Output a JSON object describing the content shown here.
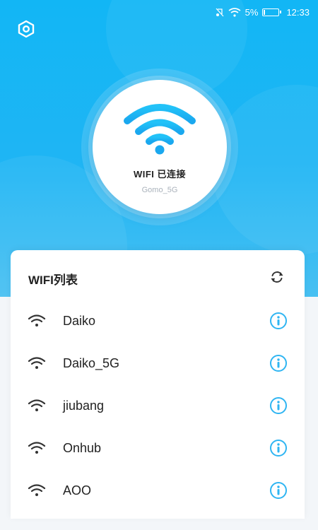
{
  "status_bar": {
    "battery_percent": "5%",
    "time": "12:33",
    "icons": [
      "mute-icon",
      "wifi-status-icon",
      "battery-icon"
    ]
  },
  "header": {
    "settings_icon": "settings-hexagon-icon"
  },
  "connection": {
    "status_text": "WIFI 已连接",
    "ssid": "Gomo_5G",
    "icon": "wifi-large-icon"
  },
  "wifi_list": {
    "title": "WIFI列表",
    "refresh_icon": "refresh-icon",
    "items": [
      {
        "name": "Daiko"
      },
      {
        "name": "Daiko_5G"
      },
      {
        "name": "jiubang"
      },
      {
        "name": "Onhub"
      },
      {
        "name": "AOO"
      }
    ]
  },
  "colors": {
    "primary": "#1bb3f5",
    "accent_info": "#2fb5f2",
    "text_dark": "#222222",
    "text_muted": "#aab2bb"
  }
}
